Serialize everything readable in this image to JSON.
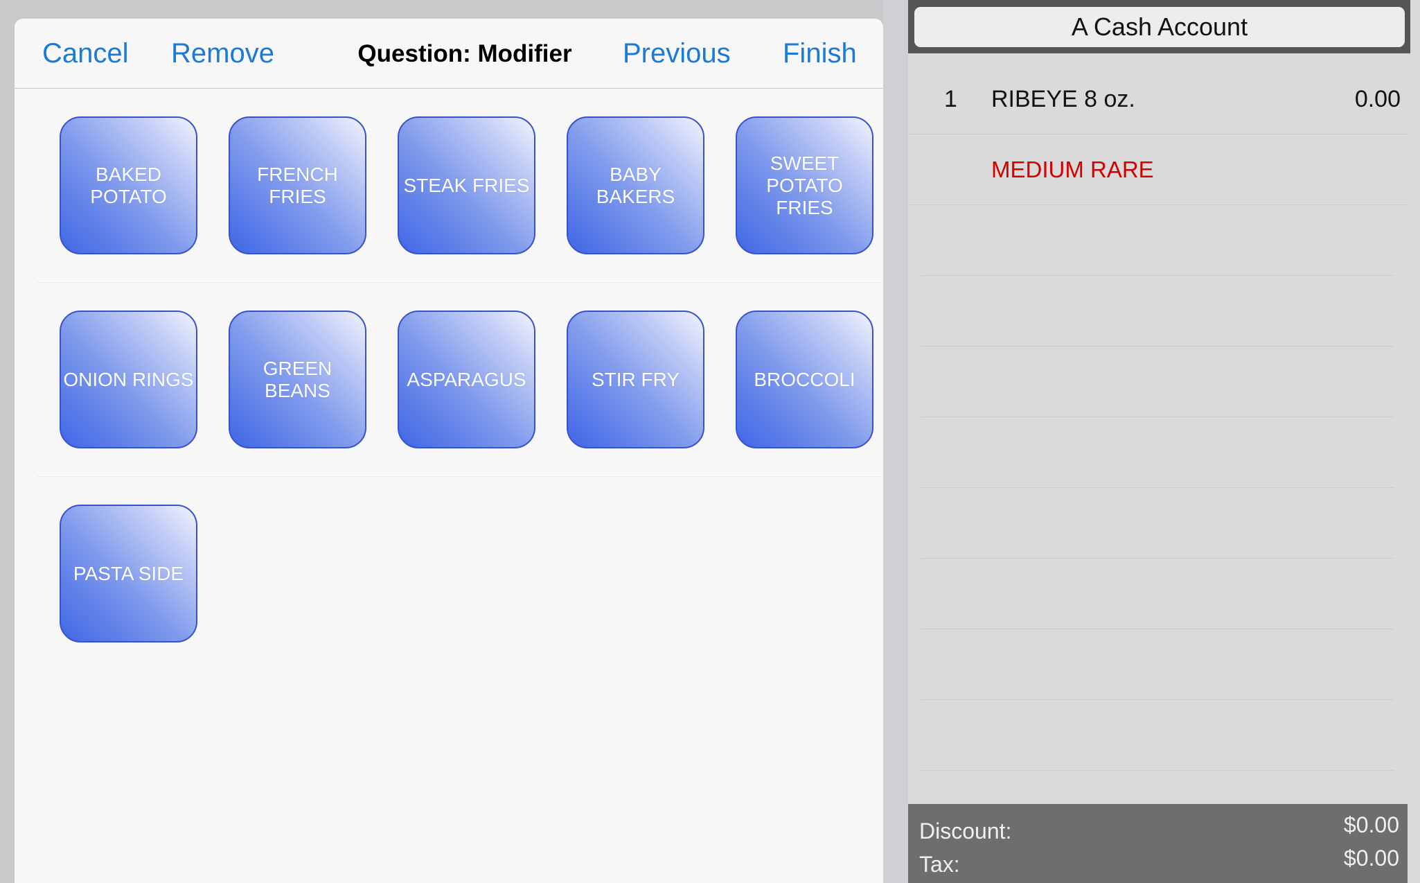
{
  "header": {
    "cancel_label": "Cancel",
    "remove_label": "Remove",
    "title": "Question: Modifier",
    "previous_label": "Previous",
    "finish_label": "Finish"
  },
  "modifiers": [
    "BAKED\nPOTATO",
    "FRENCH\nFRIES",
    "STEAK FRIES",
    "BABY BAKERS",
    "SWEET\nPOTATO\nFRIES",
    "ONION RINGS",
    "GREEN\nBEANS",
    "ASPARAGUS",
    "STIR FRY",
    "BROCCOLI",
    "PASTA SIDE"
  ],
  "account": {
    "name": "A Cash Account"
  },
  "order": {
    "item": {
      "qty": "1",
      "name": "RIBEYE 8 oz.",
      "price": "0.00",
      "modifier": "MEDIUM RARE"
    }
  },
  "totals": {
    "discount_label": "Discount:",
    "discount_value": "$0.00",
    "tax_label": "Tax:",
    "tax_value": "$0.00"
  },
  "colors": {
    "link_blue": "#1a7ad6",
    "button_blue": "#3f66e6",
    "modifier_red": "#d30000"
  }
}
